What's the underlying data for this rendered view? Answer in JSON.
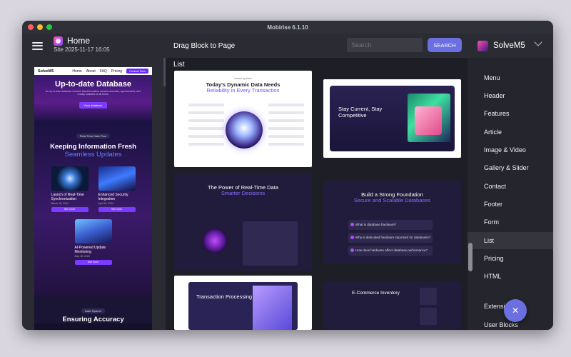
{
  "window": {
    "title": "Mobirise 6.1.10"
  },
  "left": {
    "home_title": "Home",
    "site_label": "Site 2025-11-17 16:05",
    "preview": {
      "brand": "SolveM5",
      "nav": [
        "Home",
        "About",
        "FAQ",
        "Pricing"
      ],
      "nav_button": "Contact Now",
      "hero_title": "Up-to-date Database",
      "hero_text": "An up-to-date database ensures that information remains accurate, synchronized, and readily available at all times.",
      "hero_cta": "View database",
      "pill1": "Real-Time Data Flow",
      "sec_title": "Keeping Information Fresh",
      "sec_subtitle": "Seamless Updates",
      "cards": [
        {
          "title": "Launch of Real-Time Synchronization",
          "date": "March 15, 2024",
          "button": "See more"
        },
        {
          "title": "Enhanced Security Integration",
          "date": "April 10, 2024",
          "button": "See more"
        },
        {
          "title": "AI-Powered Update Monitoring",
          "date": "May 18, 2024",
          "button": "See more"
        }
      ],
      "pill2": "Data System",
      "foot_title": "Ensuring Accuracy"
    }
  },
  "center": {
    "header": "Drag Block to Page",
    "search_placeholder": "Search",
    "search_button": "SEARCH",
    "section_label": "List",
    "thumbs": {
      "t1_pill": "Instant Updates",
      "t1_title": "Today's Dynamic Data Needs",
      "t1_subtitle": "Reliability in Every Transaction",
      "t2_title": "Stay Current, Stay Competitive",
      "t3_title": "The Power of Real-Time Data",
      "t3_subtitle": "Smarter Decisions",
      "t4_title": "Build a Strong Foundation",
      "t4_subtitle": "Secure and Scalable Databases",
      "t4_faqs": [
        "What is database hardware?",
        "Why is dedicated hardware important for databases?",
        "How does hardware affect database performance?"
      ],
      "t5_title": "Transaction Processing",
      "t6_title": "E-Commerce Inventory"
    }
  },
  "right": {
    "site_name": "SolveM5",
    "menu": [
      "Menu",
      "Header",
      "Features",
      "Article",
      "Image & Video",
      "Gallery & Slider",
      "Contact",
      "Footer",
      "Form",
      "List",
      "Pricing",
      "HTML",
      "Extensions",
      "User Blocks"
    ],
    "active_item": "List"
  },
  "fab": {
    "icon": "close-icon",
    "glyph": "✕"
  }
}
